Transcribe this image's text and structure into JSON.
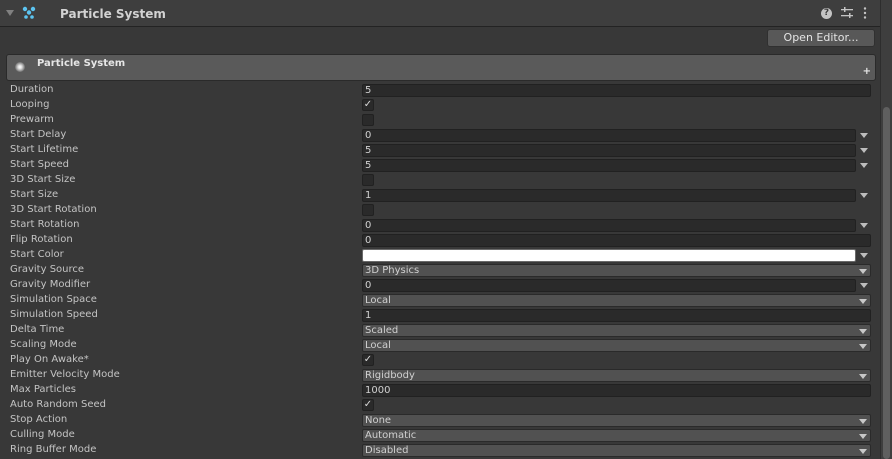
{
  "component": {
    "title": "Particle System",
    "icons": [
      "particle-system-icon",
      "help-icon",
      "presets-icon",
      "more-icon"
    ],
    "help_glyph": "?",
    "open_editor_label": "Open Editor..."
  },
  "module": {
    "title": "Particle System",
    "plus_glyph": "+"
  },
  "properties": [
    {
      "label": "Duration",
      "kind": "text",
      "value": "5"
    },
    {
      "label": "Looping",
      "kind": "checkbox",
      "checked": true
    },
    {
      "label": "Prewarm",
      "kind": "checkbox",
      "checked": false
    },
    {
      "label": "Start Delay",
      "kind": "curve",
      "value": "0"
    },
    {
      "label": "Start Lifetime",
      "kind": "curve",
      "value": "5"
    },
    {
      "label": "Start Speed",
      "kind": "curve",
      "value": "5"
    },
    {
      "label": "3D Start Size",
      "kind": "checkbox",
      "checked": false
    },
    {
      "label": "Start Size",
      "kind": "curve",
      "value": "1"
    },
    {
      "label": "3D Start Rotation",
      "kind": "checkbox",
      "checked": false
    },
    {
      "label": "Start Rotation",
      "kind": "curve",
      "value": "0"
    },
    {
      "label": "Flip Rotation",
      "kind": "text",
      "value": "0"
    },
    {
      "label": "Start Color",
      "kind": "color",
      "value": "#ffffff"
    },
    {
      "label": "Gravity Source",
      "kind": "dropdown",
      "value": "3D Physics"
    },
    {
      "label": "Gravity Modifier",
      "kind": "curve",
      "value": "0"
    },
    {
      "label": "Simulation Space",
      "kind": "dropdown",
      "value": "Local"
    },
    {
      "label": "Simulation Speed",
      "kind": "text",
      "value": "1"
    },
    {
      "label": "Delta Time",
      "kind": "dropdown",
      "value": "Scaled"
    },
    {
      "label": "Scaling Mode",
      "kind": "dropdown",
      "value": "Local"
    },
    {
      "label": "Play On Awake*",
      "kind": "checkbox",
      "checked": true
    },
    {
      "label": "Emitter Velocity Mode",
      "kind": "dropdown",
      "value": "Rigidbody"
    },
    {
      "label": "Max Particles",
      "kind": "text",
      "value": "1000"
    },
    {
      "label": "Auto Random Seed",
      "kind": "checkbox",
      "checked": true
    },
    {
      "label": "Stop Action",
      "kind": "dropdown",
      "value": "None"
    },
    {
      "label": "Culling Mode",
      "kind": "dropdown",
      "value": "Automatic"
    },
    {
      "label": "Ring Buffer Mode",
      "kind": "dropdown",
      "value": "Disabled"
    }
  ],
  "checkmark_glyph": "✓"
}
